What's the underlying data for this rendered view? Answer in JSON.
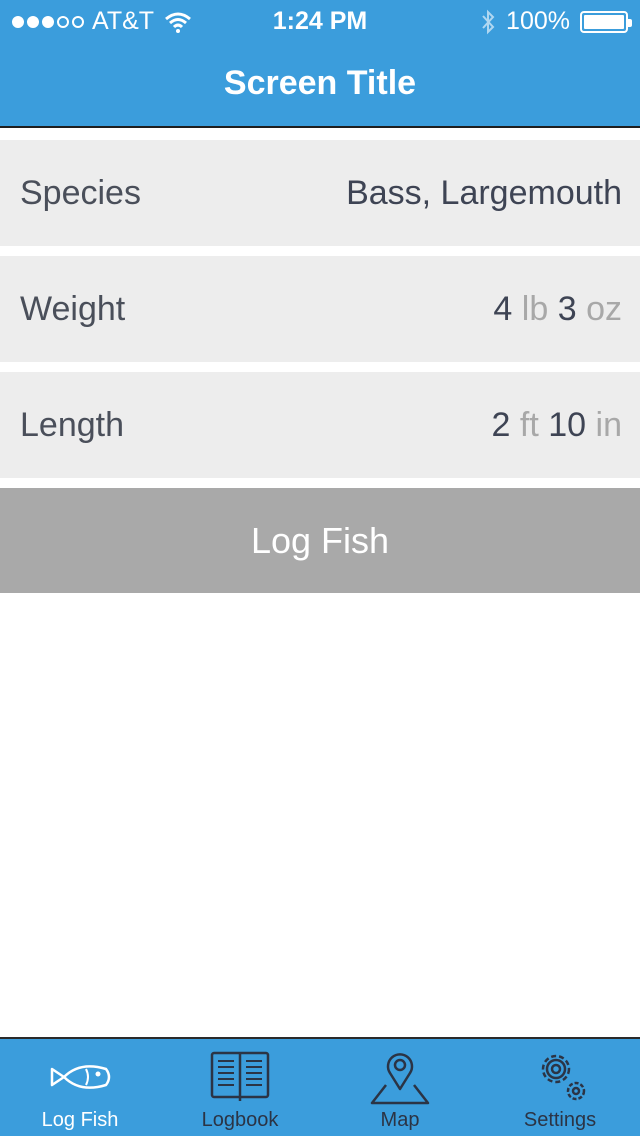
{
  "status_bar": {
    "carrier": "AT&T",
    "time": "1:24 PM",
    "battery": "100%"
  },
  "header": {
    "title": "Screen Title"
  },
  "form": {
    "species": {
      "label": "Species",
      "value": "Bass, Largemouth"
    },
    "weight": {
      "label": "Weight",
      "major": "4",
      "major_unit": "lb",
      "minor": "3",
      "minor_unit": "oz"
    },
    "length": {
      "label": "Length",
      "major": "2",
      "major_unit": "ft",
      "minor": "10",
      "minor_unit": "in"
    }
  },
  "log_button": {
    "label": "Log Fish"
  },
  "tabs": [
    {
      "label": "Log Fish",
      "icon": "fish-icon",
      "active": true
    },
    {
      "label": "Logbook",
      "icon": "book-icon",
      "active": false
    },
    {
      "label": "Map",
      "icon": "map-pin-icon",
      "active": false
    },
    {
      "label": "Settings",
      "icon": "gears-icon",
      "active": false
    }
  ],
  "colors": {
    "primary": "#3b9ddc",
    "row_bg": "#ededed",
    "button_bg": "#a9a9a9",
    "text_dark": "#3e4454",
    "unit_gray": "#a8a8a8"
  }
}
